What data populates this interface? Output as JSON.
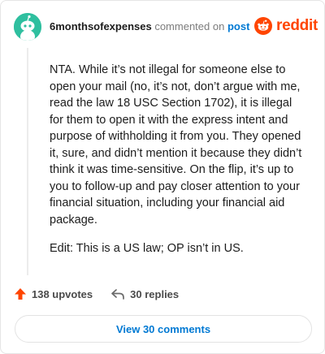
{
  "header": {
    "username": "6monthsofexpenses",
    "commented_on": "commented on",
    "post_link": "post",
    "brand": "reddit"
  },
  "comment": {
    "paragraphs": [
      "NTA. While it’s not illegal for someone else to open your mail (no, it’s not, don’t argue with me, read the law 18 USC Section 1702), it is illegal for them to open it with the express intent and purpose of withholding it from you. They opened it, sure, and didn’t mention it because they didn’t think it was time-sensitive. On the flip, it’s up to you to follow-up and pay closer attention to your financial situation, including your financial aid package.",
      "Edit: This is a US law; OP isn’t in US."
    ]
  },
  "actions": {
    "upvotes": "138 upvotes",
    "replies": "30 replies"
  },
  "view_button": "View 30 comments",
  "colors": {
    "avatar": "#2fbf9f",
    "reddit_orange": "#ff4500",
    "link_blue": "#0079d3"
  },
  "icons": {
    "avatar": "snoo-avatar-icon",
    "brand": "reddit-logo-icon",
    "upvote": "upvote-arrow-icon",
    "reply": "reply-arrow-icon"
  }
}
